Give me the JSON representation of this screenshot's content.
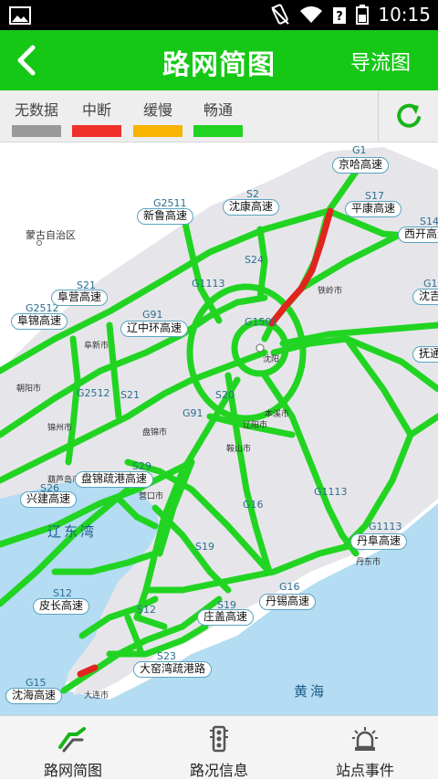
{
  "status_bar": {
    "time": "10:15"
  },
  "header": {
    "title": "路网简图",
    "right_link": "导流图"
  },
  "legend": [
    {
      "label": "无数据",
      "color": "#999999"
    },
    {
      "label": "中断",
      "color": "#f0302a"
    },
    {
      "label": "缓慢",
      "color": "#f8b400"
    },
    {
      "label": "畅通",
      "color": "#22d422"
    }
  ],
  "map": {
    "road_labels": [
      {
        "code": "G1",
        "name": "京哈高速"
      },
      {
        "code": "S17",
        "name": "平康高速"
      },
      {
        "code": "S14",
        "name": "西开高速"
      },
      {
        "code": "S2",
        "name": "沈康高速"
      },
      {
        "code": "G2511",
        "name": "新鲁高速"
      },
      {
        "code": "S21",
        "name": "阜营高速"
      },
      {
        "code": "G2512",
        "name": "阜锦高速"
      },
      {
        "code": "G91",
        "name": "辽中环高速"
      },
      {
        "code": "G1",
        "name": "沈吉"
      },
      {
        "code": "",
        "name": "抚通"
      },
      {
        "code": "S29",
        "name": "盘锦疏港高速"
      },
      {
        "code": "S26",
        "name": "兴建高速"
      },
      {
        "code": "G1113",
        "name": "丹阜高速"
      },
      {
        "code": "G16",
        "name": "丹锡高速"
      },
      {
        "code": "S12",
        "name": "皮长高速"
      },
      {
        "code": "S19",
        "name": "庄盖高速"
      },
      {
        "code": "S23",
        "name": "大窑湾疏港路"
      },
      {
        "code": "G15",
        "name": "沈海高速"
      }
    ],
    "road_codes": [
      "G1113",
      "G1501",
      "S24",
      "S20",
      "G91",
      "S21",
      "G2512",
      "G16",
      "G1113",
      "S19",
      "S12"
    ],
    "cities": [
      "铁岭市",
      "沈阳",
      "阜新市",
      "朝阳市",
      "锦州市",
      "盘锦市",
      "辽阳市",
      "本溪市",
      "鞍山市",
      "营口市",
      "葫芦岛市",
      "丹东市",
      "大连市"
    ],
    "region": "蒙古自治区",
    "seas": [
      "辽东湾",
      "黄海"
    ]
  },
  "bottom_nav": [
    {
      "label": "路网简图"
    },
    {
      "label": "路况信息"
    },
    {
      "label": "站点事件"
    }
  ]
}
